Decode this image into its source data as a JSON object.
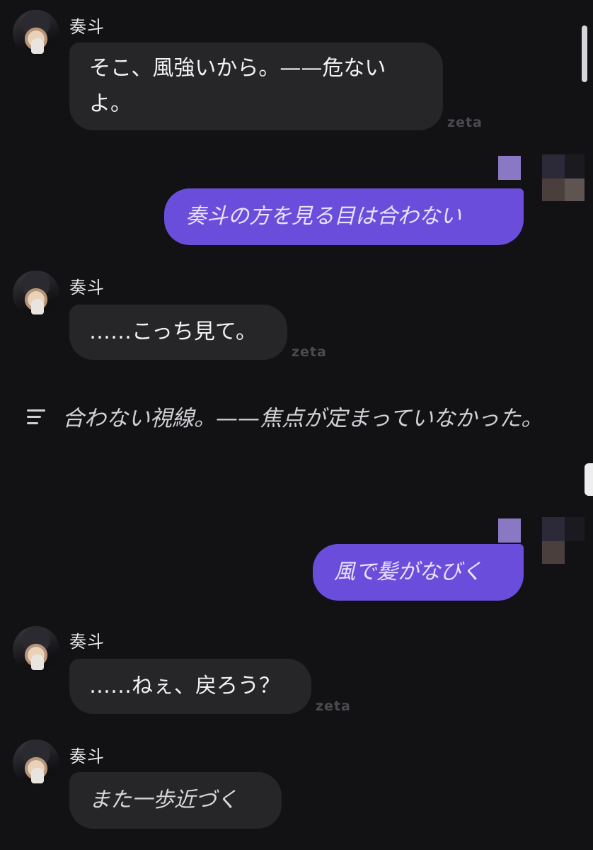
{
  "messages": [
    {
      "name": "奏斗",
      "text_line1": "そこ、風強いから。——危ない",
      "text_line2": "よ。",
      "watermark": "zeta"
    },
    {
      "text": "奏斗の方を見る目は合わない"
    },
    {
      "name": "奏斗",
      "text": "……こっち見て。",
      "watermark": "zeta"
    },
    {
      "narration": "合わない視線。——焦点が定まっていなかった。"
    },
    {
      "text": "風で髪がなびく"
    },
    {
      "name": "奏斗",
      "text": "……ねぇ、戻ろう？",
      "watermark": "zeta"
    },
    {
      "name": "奏斗",
      "text": "また一歩近づく"
    }
  ],
  "icons": {
    "avatar": "character-avatar",
    "narration": "text-lines-icon",
    "user": "pixelated-avatar"
  },
  "colors": {
    "background": "#121214",
    "ai_bubble": "#262629",
    "user_bubble": "#6a4edb"
  }
}
